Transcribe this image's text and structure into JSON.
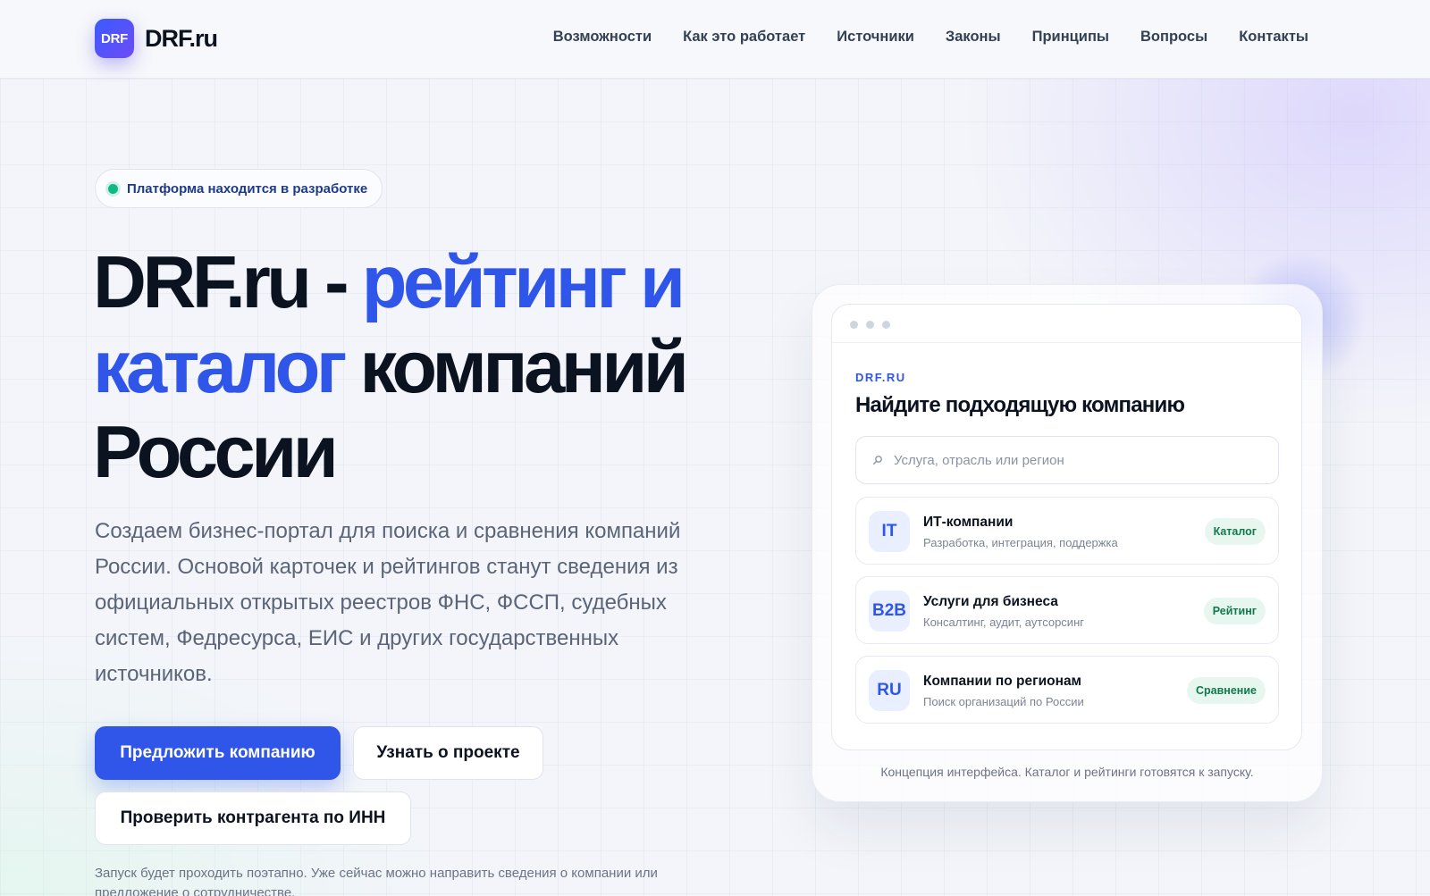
{
  "header": {
    "logo_text": "DRF",
    "brand_name": "DRF.ru",
    "nav": [
      "Возможности",
      "Как это работает",
      "Источники",
      "Законы",
      "Принципы",
      "Вопросы",
      "Контакты"
    ]
  },
  "hero": {
    "badge": "Платформа находится в разработке",
    "title_part1": "DRF.ru - ",
    "title_accent": "рейтинг и каталог",
    "title_part2": "компаний России",
    "description": "Создаем бизнес-портал для поиска и сравнения компаний России. Основой карточек и рейтингов станут сведения из официальных открытых реестров ФНС, ФССП, судебных систем, Федресурса, ЕИС и других государственных источников.",
    "primary_button": "Предложить компанию",
    "secondary_button": "Узнать о проекте",
    "third_button": "Проверить контрагента по ИНН",
    "footnote": "Запуск будет проходить поэтапно. Уже сейчас можно направить сведения о компании или предложение о сотрудничестве."
  },
  "mock": {
    "brand": "DRF.RU",
    "heading": "Найдите подходящую компанию",
    "search_placeholder": "Услуга, отрасль или регион",
    "categories": [
      {
        "icon": "IT",
        "title": "ИТ-компании",
        "subtitle": "Разработка, интеграция, поддержка",
        "tag": "Каталог"
      },
      {
        "icon": "B2B",
        "title": "Услуги для бизнеса",
        "subtitle": "Консалтинг, аудит, аутсорсинг",
        "tag": "Рейтинг"
      },
      {
        "icon": "RU",
        "title": "Компании по регионам",
        "subtitle": "Поиск организаций по России",
        "tag": "Сравнение"
      }
    ],
    "caption": "Концепция интерфейса. Каталог и рейтинги готовятся к запуску."
  },
  "colors": {
    "accent": "#2f56e8",
    "status_dot": "#10b981",
    "tag_bg": "#e7f7ef",
    "tag_text": "#0f7a4d"
  }
}
